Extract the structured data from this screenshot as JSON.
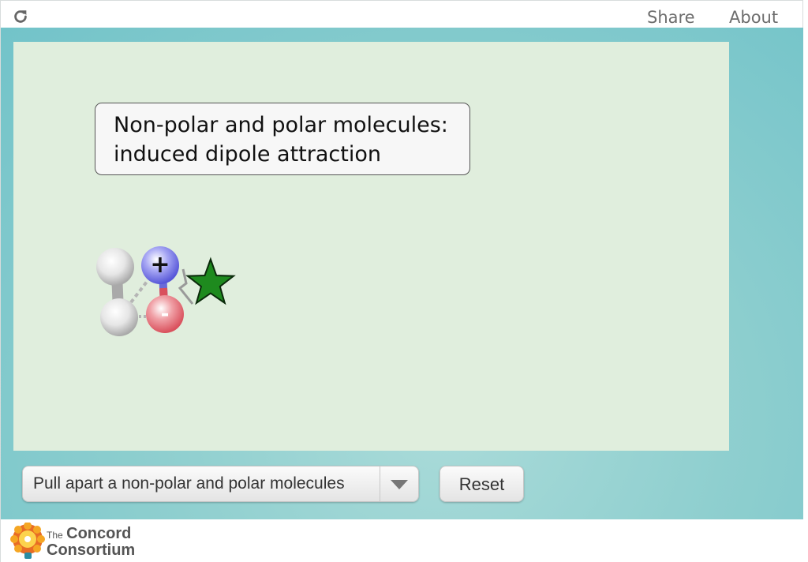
{
  "topbar": {
    "reload_icon": "reload-icon",
    "share_label": "Share",
    "about_label": "About"
  },
  "simulation": {
    "title_line1": "Non-polar and polar molecules:",
    "title_line2": "induced dipole attraction",
    "polar_molecule": {
      "positive_label": "+",
      "negative_label": "-"
    },
    "colors": {
      "background": "#e0eedd",
      "positive_atom": "#7b7bea",
      "negative_atom": "#e26d75",
      "neutral_atom": "#d9d9d9",
      "star": "#1e8a1e"
    }
  },
  "controls": {
    "scenario_select": {
      "selected": "Pull apart a non-polar and polar molecules",
      "icon": "chevron-down-icon"
    },
    "reset_label": "Reset"
  },
  "footer": {
    "logo_the": "The",
    "logo_line1": "Concord",
    "logo_line2": "Consortium"
  }
}
